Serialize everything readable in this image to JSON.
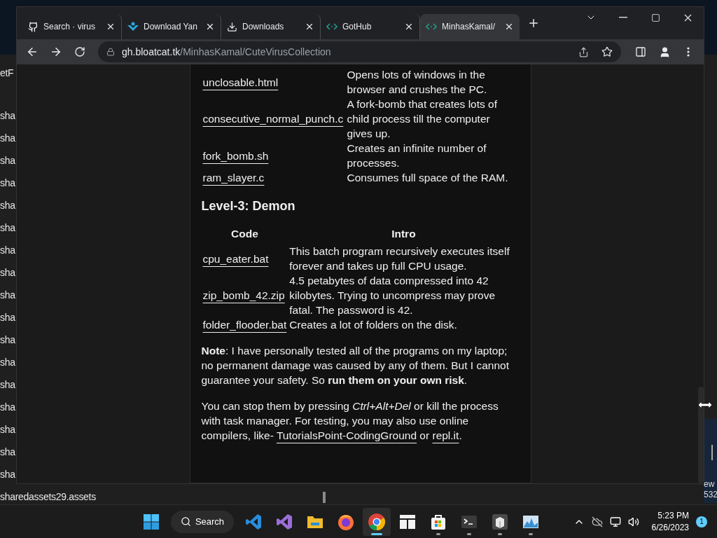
{
  "background_window": {
    "lines": [
      "etF",
      "sha",
      "sha",
      "sha",
      "sha",
      "sha",
      "sha",
      "sha",
      "sha",
      "sha",
      "sha",
      "sha",
      "sha",
      "sha",
      "sha",
      "sha",
      "sha",
      "sha",
      "sharedassets29.assets"
    ],
    "side_lines": [
      "ew",
      "532"
    ]
  },
  "browser": {
    "tabs": [
      {
        "label": "Search · virus",
        "kind": "github",
        "selected": false
      },
      {
        "label": "Download Yan",
        "kind": "app",
        "selected": false
      },
      {
        "label": "Downloads",
        "kind": "download",
        "selected": false
      },
      {
        "label": "GotHub",
        "kind": "code",
        "selected": false
      },
      {
        "label": "MinhasKamal/",
        "kind": "code",
        "selected": true
      }
    ],
    "address": {
      "domain": "gh.bloatcat.tk",
      "path": "/MinhasKamal/CuteVirusCollection"
    },
    "content": {
      "table_1": {
        "rows": [
          {
            "code": "unclosable.html",
            "intro": "Opens lots of windows in the browser and crushes the PC."
          },
          {
            "code": "consecutive_normal_punch.c",
            "intro": "A fork-bomb that creates lots of child process till the computer gives up."
          },
          {
            "code": "fork_bomb.sh",
            "intro": "Creates an infinite number of processes."
          },
          {
            "code": "ram_slayer.c",
            "intro": "Consumes full space of the RAM."
          }
        ]
      },
      "heading": "Level-3: Demon",
      "table_2": {
        "columns": [
          "Code",
          "Intro"
        ],
        "rows": [
          {
            "code": "cpu_eater.bat",
            "intro": "This batch program recursively executes itself forever and takes up full CPU usage."
          },
          {
            "code": "zip_bomb_42.zip",
            "intro": "4.5 petabytes of data compressed into 42 kilobytes. Trying to uncompress may prove fatal. The password is 42."
          },
          {
            "code": "folder_flooder.bat",
            "intro": "Creates a lot of folders on the disk."
          }
        ]
      },
      "note": [
        {
          "kind": "text",
          "text": "**Note**: I have personally tested all of the programs on my laptop; no permanent damage was caused by any of them. But I cannot guarantee your safety. So **run them on your own risk**."
        }
      ],
      "paragraph": [
        {
          "kind": "text",
          "text": "You can stop them by pressing *Ctrl+Alt+Del* or kill the process with task manager. For testing, you may also use online compilers, like- "
        },
        {
          "kind": "link",
          "text": "TutorialsPoint-CodingGround"
        },
        {
          "kind": "text",
          "text": " or "
        },
        {
          "kind": "link",
          "text": "repl.it"
        },
        {
          "kind": "text",
          "text": "."
        }
      ]
    }
  },
  "taskbar": {
    "search": "Search",
    "apps": [
      {
        "kind": "vscode",
        "selected": false,
        "running": false
      },
      {
        "kind": "visualstudio",
        "selected": false,
        "running": false
      },
      {
        "kind": "explorer",
        "selected": false,
        "running": false
      },
      {
        "kind": "firefox",
        "selected": false,
        "running": false
      },
      {
        "kind": "chrome",
        "selected": true,
        "running": true
      },
      {
        "kind": "tiles",
        "selected": false,
        "running": false
      },
      {
        "kind": "store",
        "selected": false,
        "running": true
      },
      {
        "kind": "terminal",
        "selected": false,
        "running": true
      },
      {
        "kind": "package",
        "selected": false,
        "running": true
      },
      {
        "kind": "monitor",
        "selected": false,
        "running": true
      }
    ],
    "time": "5:23 PM",
    "date": "6/26/2023",
    "notifications": "1"
  }
}
